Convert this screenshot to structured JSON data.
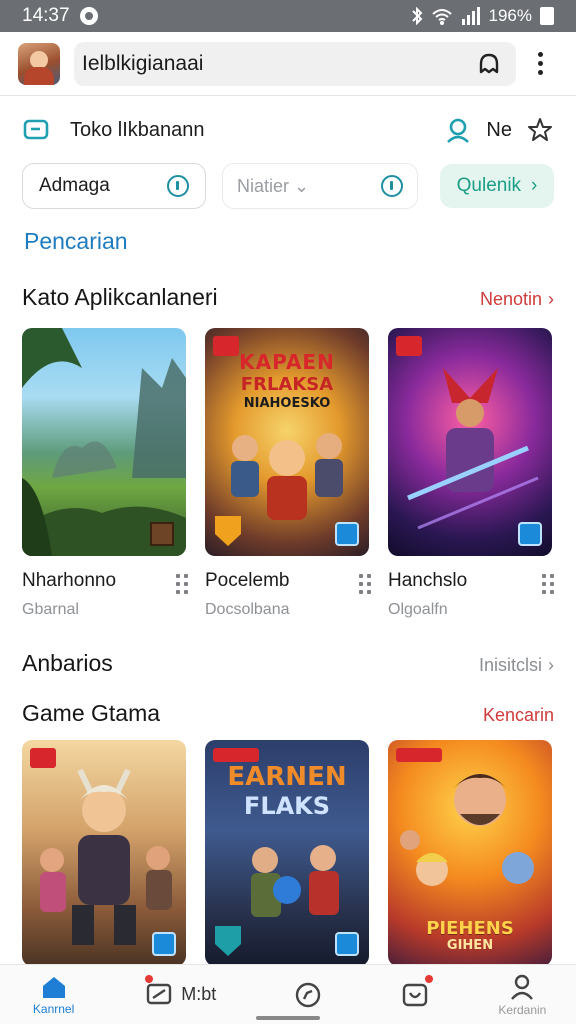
{
  "status_bar": {
    "time": "14:37",
    "battery": "196%"
  },
  "app_bar": {
    "title": "Ielblkigianaai"
  },
  "store": {
    "title": "Toko lIkbanann",
    "right_label": "Ne"
  },
  "filters": {
    "chip1": "Admaga",
    "chip2": "Niatier",
    "chip3": "Qulenik"
  },
  "search_link": "Pencarian",
  "section1": {
    "title": "Kato Aplikcanlaneri",
    "more": "Nenotin",
    "cards": [
      {
        "name": "Nharhonno",
        "sub": "Gbarnal"
      },
      {
        "name": "Pocelemb",
        "sub": "Docsolbana",
        "art": [
          "KAPAEN",
          "FRLAKSA",
          "NIAHOESKO"
        ]
      },
      {
        "name": "Hanchslo",
        "sub": "Olgoalfn"
      }
    ]
  },
  "section2": {
    "title": "Anbarios",
    "more": "Inisitclsi"
  },
  "section3": {
    "title": "Game Gtama",
    "more": "Kencarin",
    "cards": [
      {
        "art": []
      },
      {
        "art": [
          "EARNEN",
          "FLAKS"
        ]
      },
      {
        "art": [
          "PIEHENS",
          "GIHEN"
        ]
      }
    ]
  },
  "bottom_nav": {
    "home": "Kanrnel",
    "inline_label": "M:bt",
    "right_label": "Kerdanin"
  },
  "colors": {
    "accent": "#1f7cc1",
    "link_red": "#cf3b3b",
    "chip_green": "#1b9e86"
  }
}
